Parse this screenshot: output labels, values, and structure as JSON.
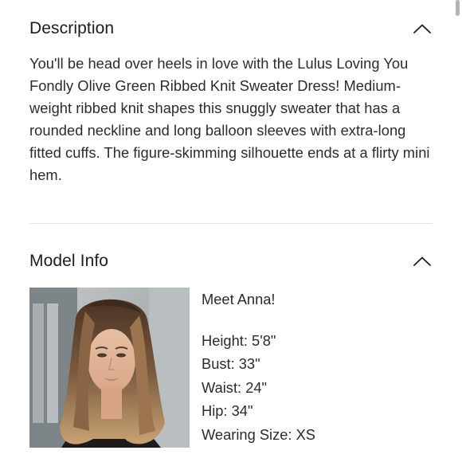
{
  "description": {
    "title": "Description",
    "body": "You'll be head over heels in love with the Lulus Loving You Fondly Olive Green Ribbed Knit Sweater Dress! Medium-weight ribbed knit shapes this snuggly sweater that has a rounded neckline and long balloon sleeves with extra-long fitted cuffs. The figure-skimming silhouette ends at a flirty mini hem.",
    "toggle_icon": "chevron-up-icon"
  },
  "model_info": {
    "title": "Model Info",
    "toggle_icon": "chevron-up-icon",
    "meet": "Meet Anna!",
    "stats": [
      {
        "label": "Height:",
        "value": "5'8\""
      },
      {
        "label": "Bust:",
        "value": "33\""
      },
      {
        "label": "Waist:",
        "value": "24\""
      },
      {
        "label": "Hip:",
        "value": "34\""
      },
      {
        "label": "Wearing Size:",
        "value": "XS"
      }
    ]
  }
}
